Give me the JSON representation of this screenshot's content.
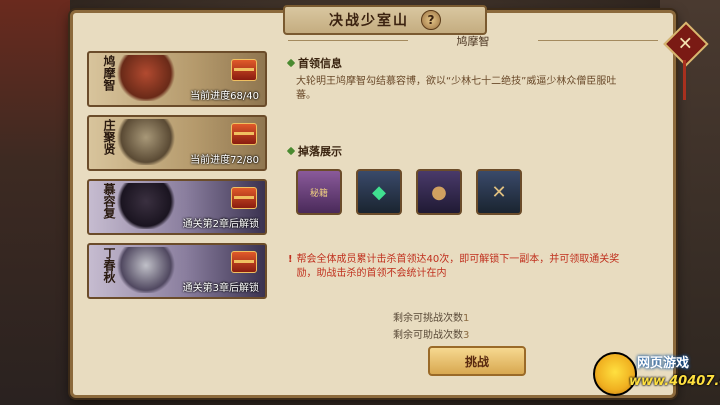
{
  "dialog": {
    "title": "决战少室山",
    "help_icon": "?",
    "close_icon": "✕"
  },
  "bosses": [
    {
      "name": "鸠摩智",
      "status": "当前进度68/40",
      "locked": false
    },
    {
      "name": "庄聚贤",
      "status": "当前进度72/80",
      "locked": false
    },
    {
      "name": "慕容复",
      "status": "通关第2章后解锁",
      "locked": true
    },
    {
      "name": "丁春秋",
      "status": "通关第3章后解锁",
      "locked": true
    }
  ],
  "selected": {
    "name": "鸠摩智",
    "info_title": "首领信息",
    "description": "大轮明王鸠摩智勾结慕容博，欲以“少林七十二绝技”威逼少林众僧臣服吐蕃。",
    "drops_title": "掉落展示",
    "drops": [
      {
        "icon": "skill-book-icon",
        "glyph": "秘籍"
      },
      {
        "icon": "jade-gem-icon",
        "glyph": "◆"
      },
      {
        "icon": "gourd-bag-icon",
        "glyph": "●"
      },
      {
        "icon": "treasure-map-icon",
        "glyph": "✕"
      }
    ]
  },
  "notice": {
    "mark": "!",
    "text": "帮会全体成员累计击杀首领达40次，即可解锁下一副本，并可领取通关奖励，助战击杀的首领不会统计在内"
  },
  "counts": {
    "challenge_label": "剩余可挑战次数",
    "challenge_value": "1",
    "assist_label": "剩余可助战次数",
    "assist_value": "3"
  },
  "challenge_button": "挑战",
  "watermark": {
    "line1": "网页游戏",
    "line2": "www.40407.com"
  }
}
